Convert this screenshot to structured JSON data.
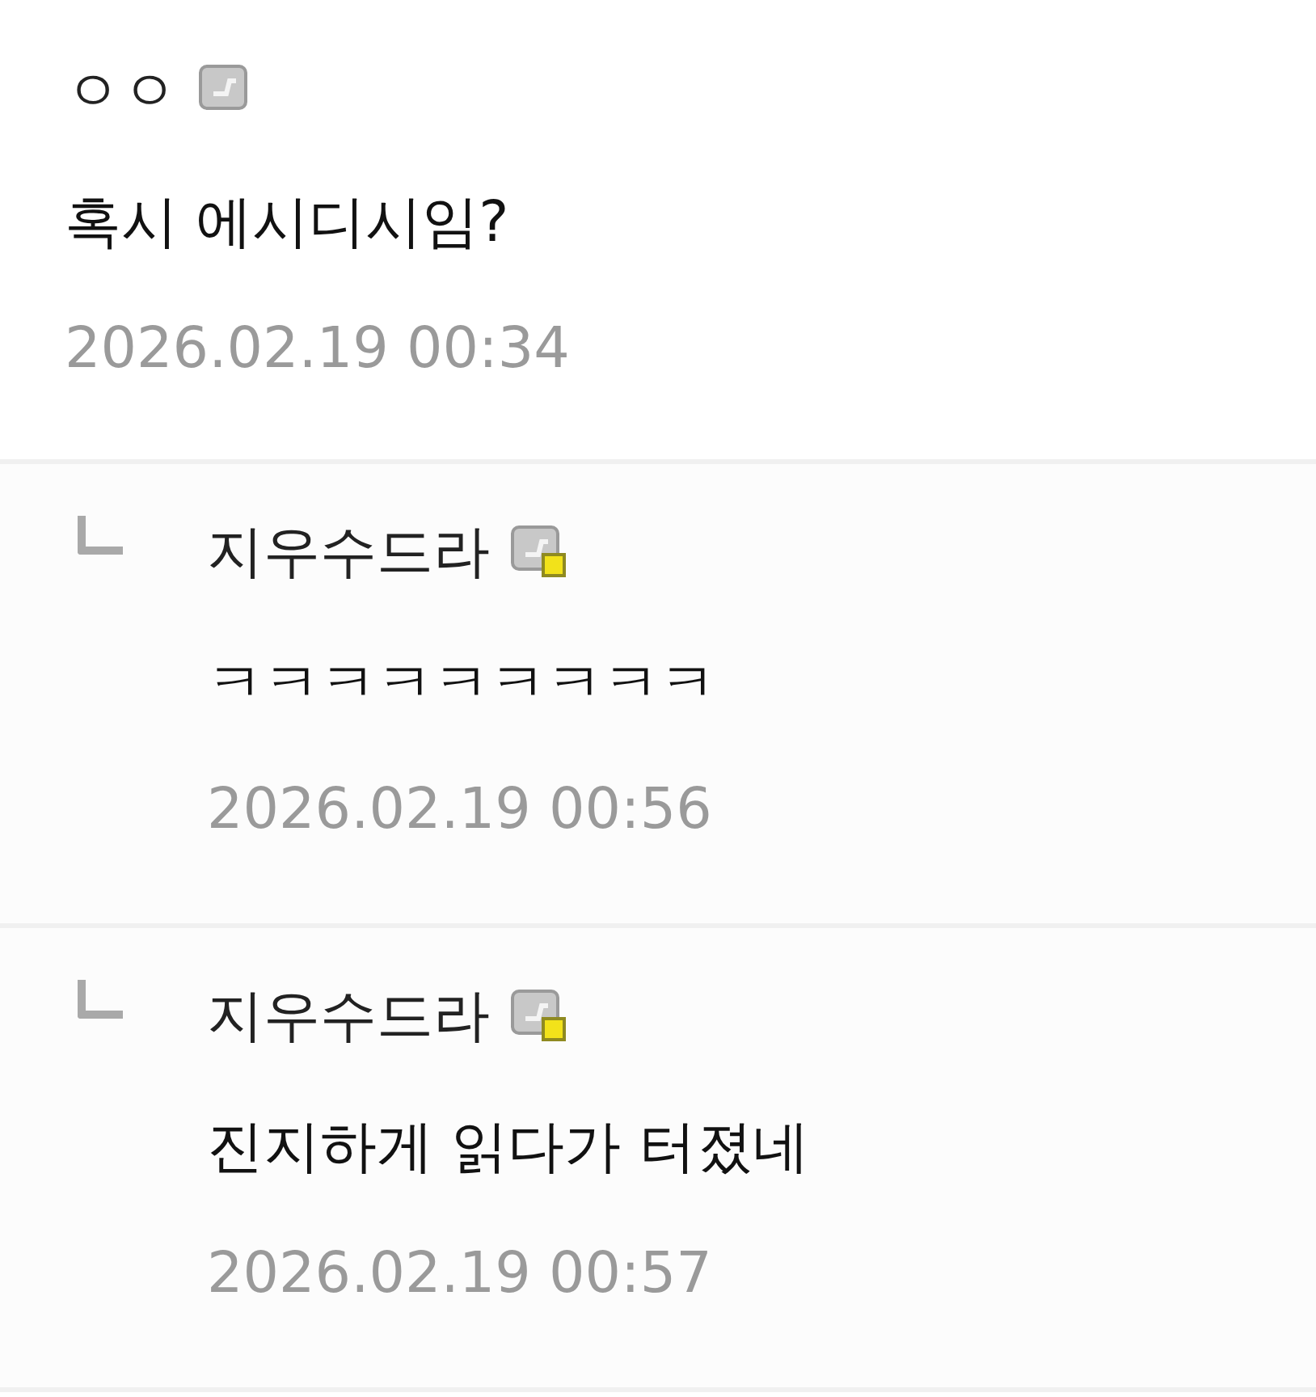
{
  "comments": [
    {
      "kind": "comment",
      "author": "ㅇㅇ",
      "badge_marked": false,
      "text": "혹시 에시디시임?",
      "date": "2026.02.19 00:34"
    },
    {
      "kind": "reply",
      "author": "지우수드라",
      "badge_marked": true,
      "text": "ㅋㅋㅋㅋㅋㅋㅋㅋㅋ",
      "date": "2026.02.19 00:56"
    },
    {
      "kind": "reply",
      "author": "지우수드라",
      "badge_marked": true,
      "text": "진지하게 읽다가 터졌네",
      "date": "2026.02.19 00:57"
    }
  ]
}
